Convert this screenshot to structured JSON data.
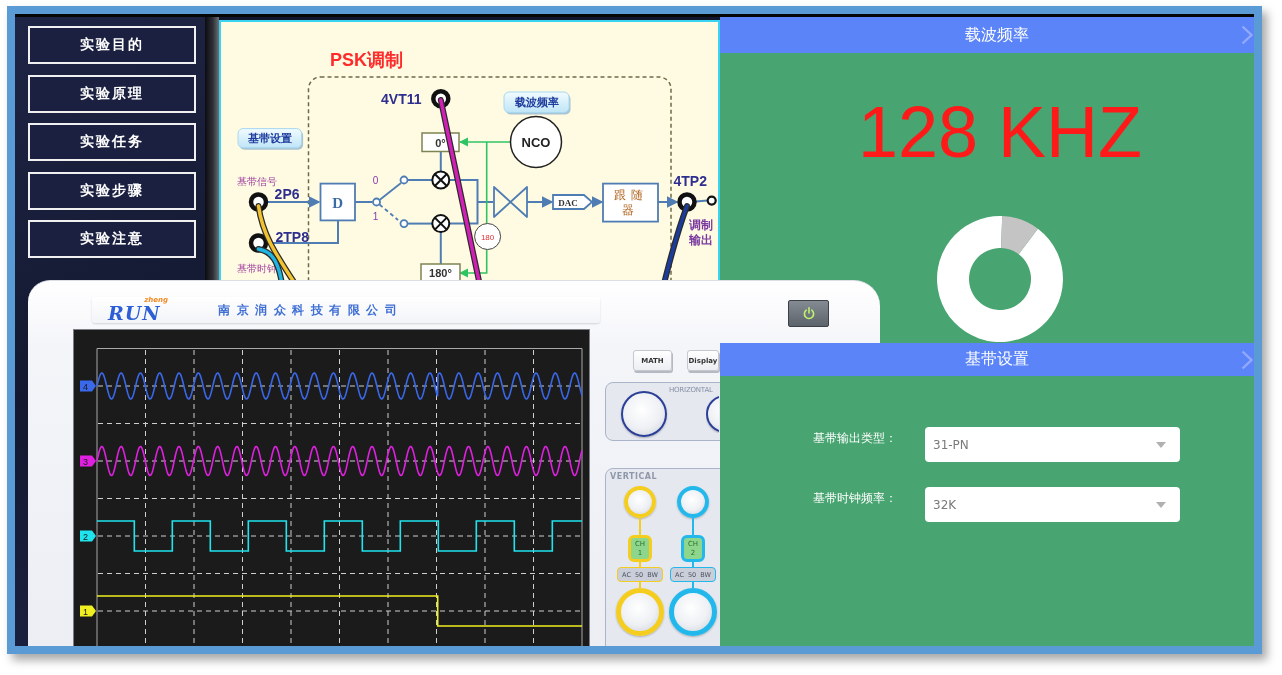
{
  "sidebar": {
    "items": [
      {
        "label": "实验目的"
      },
      {
        "label": "实验原理"
      },
      {
        "label": "实验任务"
      },
      {
        "label": "实验步骤"
      },
      {
        "label": "实验注意"
      }
    ]
  },
  "diagram": {
    "title": "PSK调制",
    "buttons": [
      {
        "label": "载波频率"
      },
      {
        "label": "基带设置"
      }
    ],
    "test_points": [
      {
        "label": "4VT11"
      },
      {
        "label": "2P6"
      },
      {
        "label": "2TP8"
      },
      {
        "label": "4TP2"
      }
    ],
    "signal_labels": [
      "基带信号",
      "基带时钟"
    ],
    "blocks": {
      "nco": "NCO",
      "phase_0": "0°",
      "phase_180": "180°",
      "phase_shifter": "180",
      "d_block": "D",
      "dac": "DAC",
      "follower": "跟随器"
    },
    "switch_labels": [
      "0",
      "1"
    ],
    "output_label": "调制输出"
  },
  "oscilloscope": {
    "logo": "RUN",
    "logo_sub": "zheng",
    "company": "南京润众科技有限公司",
    "channels": [
      {
        "label": "4",
        "color": "#3a68ea",
        "kind": "psk"
      },
      {
        "label": "3",
        "color": "#e020e0",
        "kind": "sine"
      },
      {
        "label": "2",
        "color": "#1fe4ee",
        "kind": "clock"
      },
      {
        "label": "1",
        "color": "#f0f020",
        "kind": "data"
      }
    ],
    "buttons": [
      {
        "label": "MATH"
      },
      {
        "label": "Display"
      }
    ],
    "horizontal_label": "HORIZONTAL",
    "vertical_label": "VERTICAL",
    "channel_controls": [
      {
        "label": "CH 1",
        "color": "#f5cd1f",
        "options": [
          "AC",
          "50",
          "BW"
        ]
      },
      {
        "label": "CH 2",
        "color": "#22b8ec",
        "options": [
          "AC",
          "50",
          "BW"
        ]
      }
    ]
  },
  "carrier_panel": {
    "title": "载波频率",
    "reading": "128 KHZ"
  },
  "baseband_panel": {
    "title": "基带设置",
    "fields": [
      {
        "label": "基带输出类型：",
        "value": "31-PN"
      },
      {
        "label": "基带时钟频率：",
        "value": "32K"
      }
    ]
  }
}
